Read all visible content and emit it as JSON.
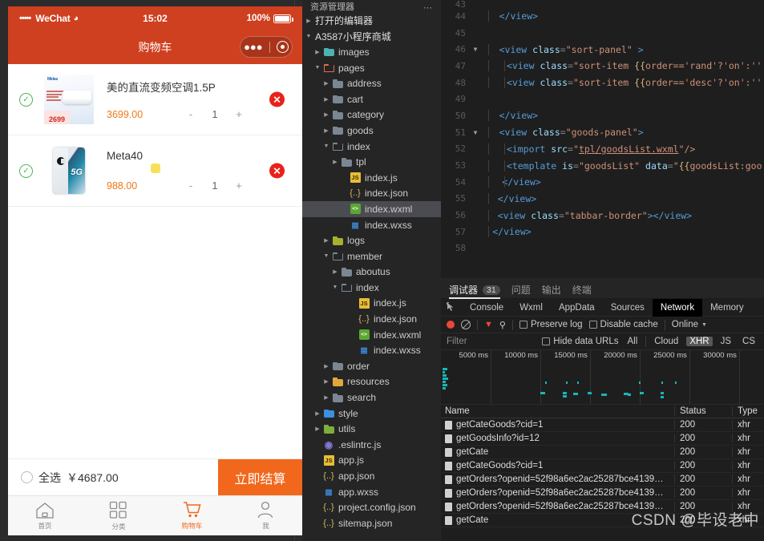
{
  "simulator": {
    "status_bar": {
      "signal_dots": "•••••",
      "carrier": "WeChat",
      "wifi_icon": "wifi-icon",
      "time": "15:02",
      "battery_text": "100%"
    },
    "nav": {
      "title": "购物车",
      "capsule_menu_icon": "more-dots-icon",
      "capsule_target_icon": "target-circle-icon"
    },
    "cart": {
      "items": [
        {
          "checked": true,
          "check_icon": "check-circle-icon",
          "name": "美的直流变频空调1.5P",
          "price": "3699.00",
          "minus": "-",
          "qty": "1",
          "plus": "+",
          "delete_icon": "close-circle-icon",
          "thumb": "air-conditioner-image",
          "thumb_price_tag": "2699",
          "thumb_logo": "Midea"
        },
        {
          "checked": true,
          "check_icon": "check-circle-icon",
          "name": "Meta40",
          "price": "988.00",
          "minus": "-",
          "qty": "1",
          "plus": "+",
          "delete_icon": "close-circle-icon",
          "thumb": "phone-image",
          "thumb_badge": "5G"
        }
      ],
      "loading_indicator": "loading-square"
    },
    "footer": {
      "select_all_label": "全选",
      "total": "￥4687.00",
      "checkout_label": "立即结算",
      "checkout_color": "#f1681c"
    },
    "tabbar": [
      {
        "icon": "home-icon",
        "label": "首页",
        "active": false
      },
      {
        "icon": "category-grid-icon",
        "label": "分类",
        "active": false
      },
      {
        "icon": "cart-icon",
        "label": "购物车",
        "active": true
      },
      {
        "icon": "user-icon",
        "label": "我",
        "active": false
      }
    ]
  },
  "explorer": {
    "title": "资源管理器",
    "more_icon": "more-dots-icon",
    "tree": [
      {
        "label": "打开的编辑器",
        "depth": 0,
        "twisty": "collapsed",
        "icon": "none",
        "kind": "section"
      },
      {
        "label": "A3587小程序商城",
        "depth": 0,
        "twisty": "expanded",
        "icon": "none",
        "kind": "section"
      },
      {
        "label": "images",
        "depth": 1,
        "twisty": "collapsed",
        "icon": "folder",
        "color": "#4cb2b2",
        "kind": "folder"
      },
      {
        "label": "pages",
        "depth": 1,
        "twisty": "expanded",
        "icon": "folder-open",
        "color": "#e06c4b",
        "kind": "folder"
      },
      {
        "label": "address",
        "depth": 2,
        "twisty": "collapsed",
        "icon": "folder",
        "color": "#7a8793",
        "kind": "folder"
      },
      {
        "label": "cart",
        "depth": 2,
        "twisty": "collapsed",
        "icon": "folder",
        "color": "#7a8793",
        "kind": "folder"
      },
      {
        "label": "category",
        "depth": 2,
        "twisty": "collapsed",
        "icon": "folder",
        "color": "#7a8793",
        "kind": "folder"
      },
      {
        "label": "goods",
        "depth": 2,
        "twisty": "collapsed",
        "icon": "folder",
        "color": "#7a8793",
        "kind": "folder"
      },
      {
        "label": "index",
        "depth": 2,
        "twisty": "expanded",
        "icon": "folder-open",
        "color": "#7a8793",
        "kind": "folder"
      },
      {
        "label": "tpl",
        "depth": 3,
        "twisty": "collapsed",
        "icon": "folder",
        "color": "#7a8793",
        "kind": "folder"
      },
      {
        "label": "index.js",
        "depth": 4,
        "twisty": "none",
        "icon": "js",
        "kind": "file"
      },
      {
        "label": "index.json",
        "depth": 4,
        "twisty": "none",
        "icon": "json",
        "kind": "file"
      },
      {
        "label": "index.wxml",
        "depth": 4,
        "twisty": "none",
        "icon": "wxml",
        "kind": "file",
        "state": "selected-focus"
      },
      {
        "label": "index.wxss",
        "depth": 4,
        "twisty": "none",
        "icon": "wxss",
        "kind": "file"
      },
      {
        "label": "logs",
        "depth": 2,
        "twisty": "collapsed",
        "icon": "folder",
        "color": "#a8b02e",
        "kind": "folder"
      },
      {
        "label": "member",
        "depth": 2,
        "twisty": "expanded",
        "icon": "folder-open",
        "color": "#7a8793",
        "kind": "folder"
      },
      {
        "label": "aboutus",
        "depth": 3,
        "twisty": "collapsed",
        "icon": "folder",
        "color": "#7a8793",
        "kind": "folder"
      },
      {
        "label": "index",
        "depth": 3,
        "twisty": "expanded",
        "icon": "folder-open",
        "color": "#7a8793",
        "kind": "folder"
      },
      {
        "label": "index.js",
        "depth": 5,
        "twisty": "none",
        "icon": "js",
        "kind": "file"
      },
      {
        "label": "index.json",
        "depth": 5,
        "twisty": "none",
        "icon": "json",
        "kind": "file"
      },
      {
        "label": "index.wxml",
        "depth": 5,
        "twisty": "none",
        "icon": "wxml",
        "kind": "file"
      },
      {
        "label": "index.wxss",
        "depth": 5,
        "twisty": "none",
        "icon": "wxss",
        "kind": "file"
      },
      {
        "label": "order",
        "depth": 2,
        "twisty": "collapsed",
        "icon": "folder",
        "color": "#7a8793",
        "kind": "folder"
      },
      {
        "label": "resources",
        "depth": 2,
        "twisty": "collapsed",
        "icon": "folder",
        "color": "#e0a93a",
        "kind": "folder"
      },
      {
        "label": "search",
        "depth": 2,
        "twisty": "collapsed",
        "icon": "folder",
        "color": "#7a8793",
        "kind": "folder"
      },
      {
        "label": "style",
        "depth": 1,
        "twisty": "collapsed",
        "icon": "folder",
        "color": "#3d8fe0",
        "kind": "folder"
      },
      {
        "label": "utils",
        "depth": 1,
        "twisty": "collapsed",
        "icon": "folder",
        "color": "#7db03a",
        "kind": "folder"
      },
      {
        "label": ".eslintrc.js",
        "depth": 1,
        "twisty": "none",
        "icon": "eslint",
        "kind": "file"
      },
      {
        "label": "app.js",
        "depth": 1,
        "twisty": "none",
        "icon": "js",
        "kind": "file"
      },
      {
        "label": "app.json",
        "depth": 1,
        "twisty": "none",
        "icon": "json",
        "kind": "file"
      },
      {
        "label": "app.wxss",
        "depth": 1,
        "twisty": "none",
        "icon": "wxss",
        "kind": "file"
      },
      {
        "label": "project.config.json",
        "depth": 1,
        "twisty": "none",
        "icon": "json",
        "kind": "file"
      },
      {
        "label": "sitemap.json",
        "depth": 1,
        "twisty": "none",
        "icon": "json",
        "kind": "file"
      }
    ]
  },
  "editor": {
    "lines": [
      {
        "num": "43",
        "fold": "",
        "indent": 0,
        "partial_top": true,
        "tokens": []
      },
      {
        "num": "44",
        "fold": "",
        "indent": 2,
        "tokens": [
          {
            "t": "</view>",
            "c": "tk-tag"
          }
        ]
      },
      {
        "num": "45",
        "fold": "",
        "indent": 0,
        "tokens": []
      },
      {
        "num": "46",
        "fold": "chevron-down",
        "indent": 2,
        "tokens": [
          {
            "t": "<view ",
            "c": "tk-tag"
          },
          {
            "t": "class",
            "c": "tk-attr"
          },
          {
            "t": "=",
            "c": "tk-punc"
          },
          {
            "t": "\"sort-panel\"",
            "c": "tk-str"
          },
          {
            "t": " >",
            "c": "tk-tag"
          }
        ]
      },
      {
        "num": "47",
        "fold": "",
        "indent": 3,
        "tokens": [
          {
            "t": "<view ",
            "c": "tk-tag"
          },
          {
            "t": "class",
            "c": "tk-attr"
          },
          {
            "t": "=",
            "c": "tk-punc"
          },
          {
            "t": "\"sort-item ",
            "c": "tk-str"
          },
          {
            "t": "{{",
            "c": "tk-mus"
          },
          {
            "t": "order=='rand'?'on':''",
            "c": "tk-str"
          }
        ]
      },
      {
        "num": "48",
        "fold": "",
        "indent": 3,
        "tokens": [
          {
            "t": "<view ",
            "c": "tk-tag"
          },
          {
            "t": "class",
            "c": "tk-attr"
          },
          {
            "t": "=",
            "c": "tk-punc"
          },
          {
            "t": "\"sort-item ",
            "c": "tk-str"
          },
          {
            "t": "{{",
            "c": "tk-mus"
          },
          {
            "t": "order=='desc'?'on':''",
            "c": "tk-str"
          }
        ]
      },
      {
        "num": "49",
        "fold": "",
        "indent": 0,
        "tokens": []
      },
      {
        "num": "50",
        "fold": "",
        "indent": 2,
        "tokens": [
          {
            "t": "</view>",
            "c": "tk-tag"
          }
        ]
      },
      {
        "num": "51",
        "fold": "chevron-down",
        "indent": 2,
        "tokens": [
          {
            "t": "<view ",
            "c": "tk-tag"
          },
          {
            "t": "class",
            "c": "tk-attr"
          },
          {
            "t": "=",
            "c": "tk-punc"
          },
          {
            "t": "\"goods-panel\"",
            "c": "tk-str"
          },
          {
            "t": ">",
            "c": "tk-tag"
          }
        ]
      },
      {
        "num": "52",
        "fold": "",
        "indent": 3,
        "tokens": [
          {
            "t": "<import ",
            "c": "tk-tag"
          },
          {
            "t": "src",
            "c": "tk-attr"
          },
          {
            "t": "=",
            "c": "tk-punc"
          },
          {
            "t": "\"",
            "c": "tk-str"
          },
          {
            "t": "tpl/goodsList.wxml",
            "c": "tk-link"
          },
          {
            "t": "\"/>",
            "c": "tk-str"
          }
        ]
      },
      {
        "num": "53",
        "fold": "",
        "indent": 3,
        "tokens": [
          {
            "t": "<template ",
            "c": "tk-tag"
          },
          {
            "t": "is",
            "c": "tk-attr"
          },
          {
            "t": "=",
            "c": "tk-punc"
          },
          {
            "t": "\"goodsList\"",
            "c": "tk-str"
          },
          {
            "t": " ",
            "c": "tk-tag"
          },
          {
            "t": "data",
            "c": "tk-attr"
          },
          {
            "t": "=",
            "c": "tk-punc"
          },
          {
            "t": "\"",
            "c": "tk-str"
          },
          {
            "t": "{{",
            "c": "tk-mus"
          },
          {
            "t": "goodsList:goo",
            "c": "tk-str"
          }
        ]
      },
      {
        "num": "54",
        "fold": "",
        "indent": 2.4,
        "tokens": [
          {
            "t": "</view>",
            "c": "tk-tag"
          }
        ]
      },
      {
        "num": "55",
        "fold": "",
        "indent": 1.8,
        "tokens": [
          {
            "t": "</view>",
            "c": "tk-tag"
          }
        ]
      },
      {
        "num": "56",
        "fold": "",
        "indent": 1.8,
        "tokens": [
          {
            "t": "<view ",
            "c": "tk-tag"
          },
          {
            "t": "class",
            "c": "tk-attr"
          },
          {
            "t": "=",
            "c": "tk-punc"
          },
          {
            "t": "\"tabbar-border\"",
            "c": "tk-str"
          },
          {
            "t": "></view>",
            "c": "tk-tag"
          }
        ]
      },
      {
        "num": "57",
        "fold": "",
        "indent": 1.1,
        "tokens": [
          {
            "t": "</view>",
            "c": "tk-tag"
          }
        ]
      },
      {
        "num": "58",
        "fold": "",
        "indent": 0,
        "tokens": []
      }
    ]
  },
  "devtools": {
    "outer_tabs": [
      {
        "label": "调试器",
        "badge": "31",
        "active": true
      },
      {
        "label": "问题",
        "badge": "",
        "active": false
      },
      {
        "label": "输出",
        "badge": "",
        "active": false
      },
      {
        "label": "终端",
        "badge": "",
        "active": false
      }
    ],
    "picker_icon": "element-picker-icon",
    "inspector_tabs": [
      {
        "label": "Console",
        "active": false
      },
      {
        "label": "Wxml",
        "active": false
      },
      {
        "label": "AppData",
        "active": false
      },
      {
        "label": "Sources",
        "active": false
      },
      {
        "label": "Network",
        "active": true
      },
      {
        "label": "Memory",
        "active": false
      }
    ],
    "toolbar": {
      "record_icon": "record-circle-icon",
      "clear_icon": "clear-icon",
      "filter_icon": "funnel-icon",
      "search_icon": "search-icon",
      "preserve_log_label": "Preserve log",
      "preserve_log_checked": false,
      "disable_cache_label": "Disable cache",
      "disable_cache_checked": false,
      "throttling_value": "Online",
      "throttling_caret": "chevron-down-icon"
    },
    "filter_row": {
      "filter_placeholder": "Filter",
      "hide_data_urls_label": "Hide data URLs",
      "hide_data_urls_checked": false,
      "types": [
        {
          "label": "All",
          "active": false
        },
        {
          "label": "Cloud",
          "active": false
        },
        {
          "label": "XHR",
          "active": true
        },
        {
          "label": "JS",
          "active": false
        },
        {
          "label": "CS",
          "active": false
        }
      ]
    },
    "waterfall": {
      "ticks": [
        "5000 ms",
        "10000 ms",
        "15000 ms",
        "20000 ms",
        "25000 ms",
        "30000 ms"
      ],
      "bar_color": "#18b5b5"
    },
    "table": {
      "columns": [
        "Name",
        "Status",
        "Type"
      ],
      "rows": [
        {
          "name": "getCateGoods?cid=1",
          "status": "200",
          "type": "xhr"
        },
        {
          "name": "getGoodsInfo?id=12",
          "status": "200",
          "type": "xhr"
        },
        {
          "name": "getCate",
          "status": "200",
          "type": "xhr"
        },
        {
          "name": "getCateGoods?cid=1",
          "status": "200",
          "type": "xhr"
        },
        {
          "name": "getOrders?openid=52f98a6ec2ac25287bce4139…",
          "status": "200",
          "type": "xhr"
        },
        {
          "name": "getOrders?openid=52f98a6ec2ac25287bce4139…",
          "status": "200",
          "type": "xhr"
        },
        {
          "name": "getOrders?openid=52f98a6ec2ac25287bce4139…",
          "status": "200",
          "type": "xhr"
        },
        {
          "name": "getCate",
          "status": "200",
          "type": "xhr"
        }
      ]
    }
  },
  "watermark": "CSDN @毕设老中"
}
